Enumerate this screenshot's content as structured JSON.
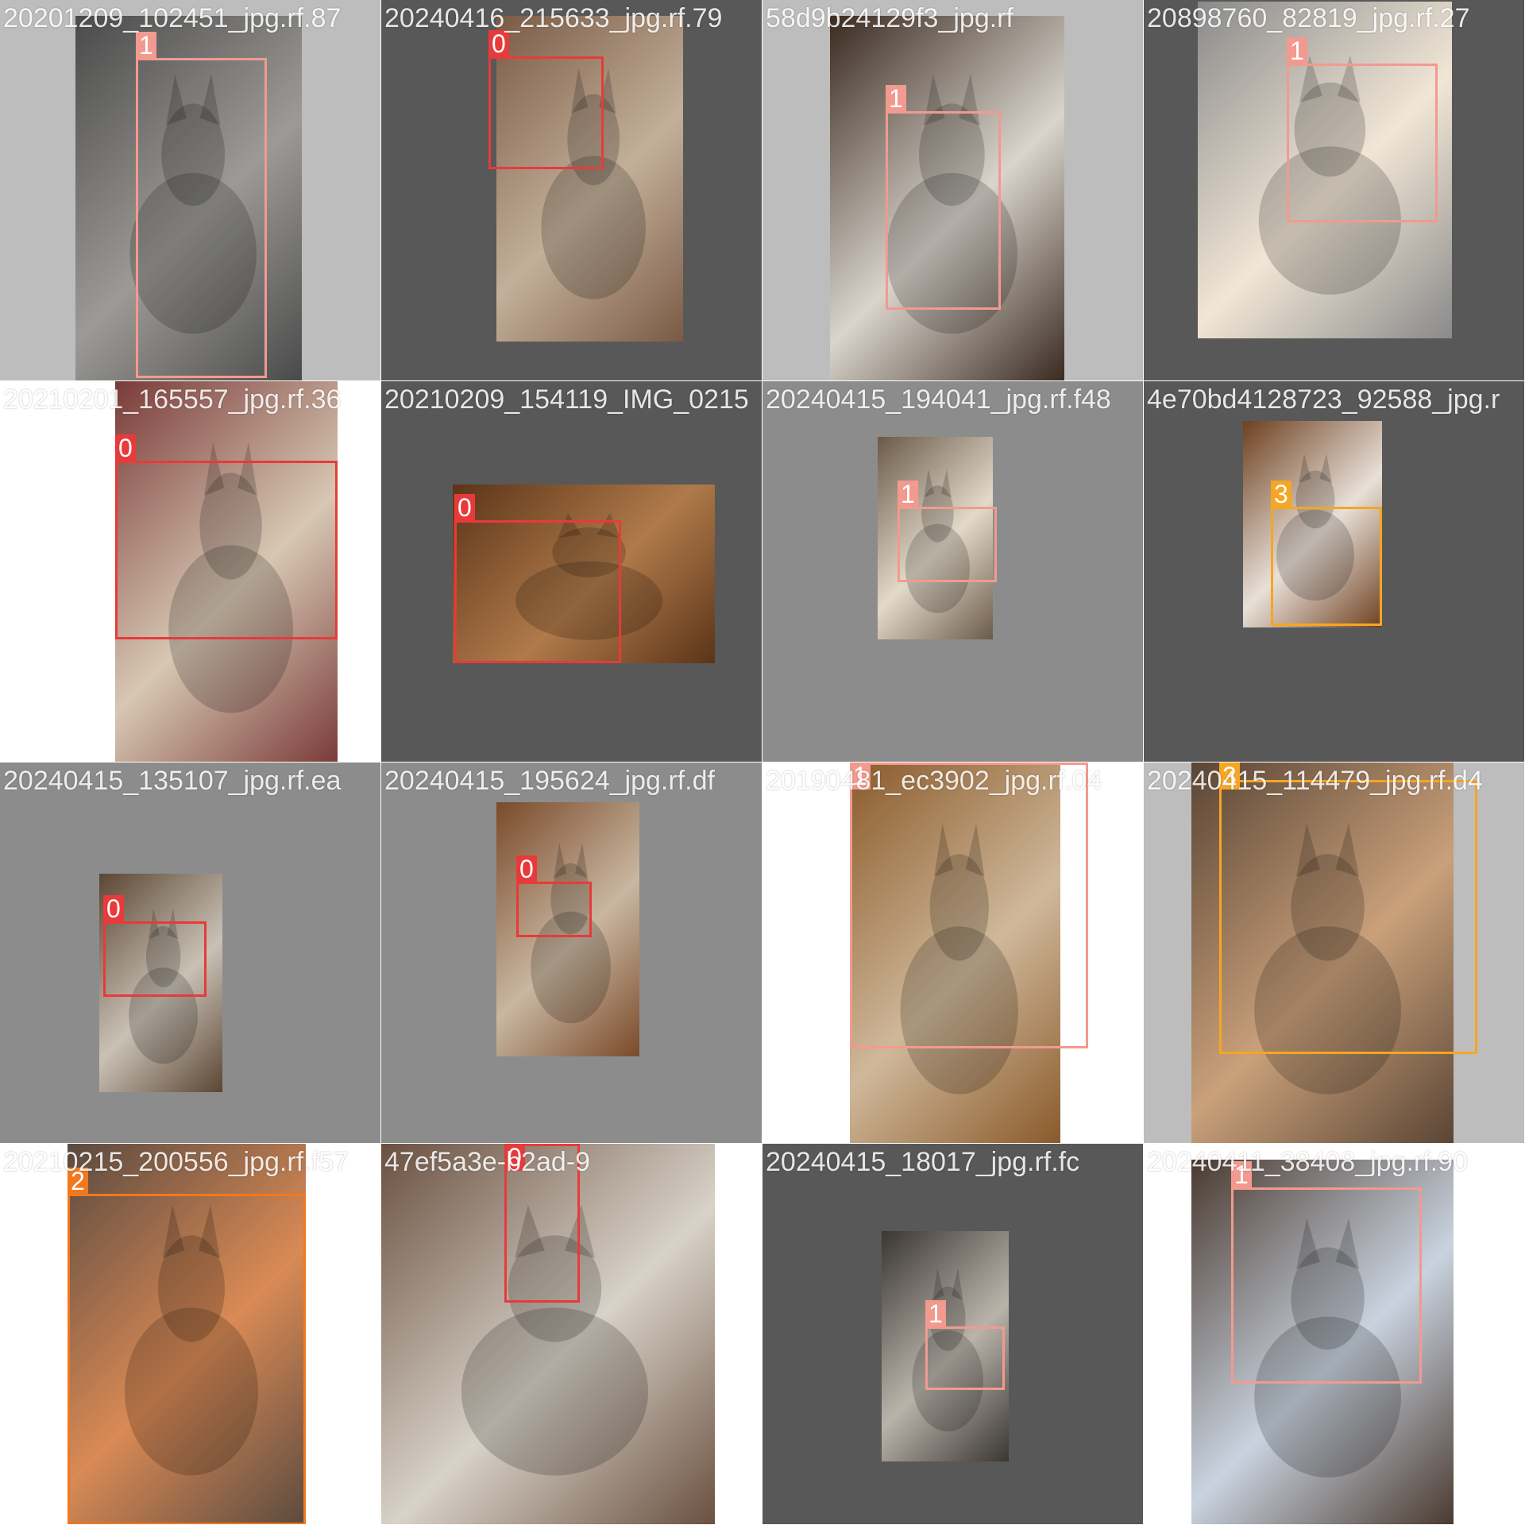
{
  "colors": {
    "class_0": "#e83a3a",
    "class_1": "#f29a8f",
    "class_2": "#f2781e",
    "class_3": "#f5a623",
    "pad_dark": "#585858",
    "pad_mid": "#8c8c8c",
    "pad_light": "#bdbdbd",
    "pad_white": "#ffffff"
  },
  "tiles": [
    {
      "filename": "20201209_102451_jpg.rf.87",
      "label": "1",
      "cls": "class_1",
      "pad": "pad_light",
      "photo": "gray-tabby-kitten-bowtie",
      "tone": [
        "#4a4a4a",
        "#9c9a96"
      ]
    },
    {
      "filename": "20240416_215633_jpg.rf.79",
      "label": "0",
      "cls": "class_0",
      "pad": "pad_dark",
      "photo": "kitten-on-wood-floor",
      "tone": [
        "#7a5a45",
        "#c3b09a"
      ]
    },
    {
      "filename": "58d9b24129f3_jpg.rf",
      "label": "1",
      "cls": "class_1",
      "pad": "pad_light",
      "photo": "cat-on-fur-blanket",
      "tone": [
        "#3a2a20",
        "#d9d4cc"
      ]
    },
    {
      "filename": "20898760_82819_jpg.rf.27",
      "label": "1",
      "cls": "class_1",
      "pad": "pad_dark",
      "photo": "gray-cat-close-up",
      "tone": [
        "#8a8a8a",
        "#f1e6d6"
      ]
    },
    {
      "filename": "20210201_165557_jpg.rf.36",
      "label": "0",
      "cls": "class_0",
      "pad": "pad_white",
      "photo": "calico-kitten-on-rug",
      "tone": [
        "#7a3b38",
        "#d7c7b3"
      ]
    },
    {
      "filename": "20210209_154119_IMG_0215",
      "label": "0",
      "cls": "class_0",
      "pad": "pad_dark",
      "photo": "kitten-on-wood-pile",
      "tone": [
        "#5b3418",
        "#b07a4a"
      ]
    },
    {
      "filename": "20240415_194041_jpg.rf.f48",
      "label": "1",
      "cls": "class_1",
      "pad": "pad_mid",
      "photo": "cat-on-stool",
      "tone": [
        "#6b5a4a",
        "#e2d9c8"
      ]
    },
    {
      "filename": "4e70bd4128723_92588_jpg.r",
      "label": "3",
      "cls": "class_3",
      "pad": "pad_dark",
      "photo": "orange-cat-on-fur",
      "tone": [
        "#6e4020",
        "#e8e0d8"
      ]
    },
    {
      "filename": "20240415_135107_jpg.rf.ea",
      "label": "0",
      "cls": "class_0",
      "pad": "pad_mid",
      "photo": "cat-in-window",
      "tone": [
        "#5b4634",
        "#c9c1b5"
      ]
    },
    {
      "filename": "20240415_195624_jpg.rf.df",
      "label": "0",
      "cls": "class_0",
      "pad": "pad_mid",
      "photo": "cat-on-floor-hallway",
      "tone": [
        "#7a4a2a",
        "#c9b7a1"
      ]
    },
    {
      "filename": "20190481_ec3902_jpg.rf.04",
      "label": "1",
      "cls": "class_1",
      "pad": "pad_white",
      "photo": "fluffy-cat-portrait",
      "tone": [
        "#8a5a2a",
        "#cfb89a"
      ]
    },
    {
      "filename": "20240415_114479_jpg.rf.d4",
      "label": "3",
      "cls": "class_3",
      "pad": "pad_light",
      "photo": "tabby-cat-on-stool",
      "tone": [
        "#5a4535",
        "#c9a07a"
      ]
    },
    {
      "filename": "20210215_200556_jpg.rf.f57",
      "label": "2",
      "cls": "class_2",
      "pad": "pad_white",
      "photo": "calico-kitten-close-up",
      "tone": [
        "#5a4a40",
        "#d98a55"
      ]
    },
    {
      "filename": "47ef5a3e-b2ad-9",
      "label": "0",
      "cls": "class_0",
      "pad": "pad_white",
      "photo": "two-cats-kitchen",
      "tone": [
        "#6a5040",
        "#d8d2c8"
      ]
    },
    {
      "filename": "20240415_18017_jpg.rf.fc",
      "label": "1",
      "cls": "class_1",
      "pad": "pad_dark",
      "photo": "cat-in-bed-curtain",
      "tone": [
        "#3a3632",
        "#b9b3aa"
      ]
    },
    {
      "filename": "20240411_38408_jpg.rf.90",
      "label": "1",
      "cls": "class_1",
      "pad": "pad_white",
      "photo": "cat-near-window",
      "tone": [
        "#4a3a30",
        "#c9d3df"
      ]
    }
  ]
}
